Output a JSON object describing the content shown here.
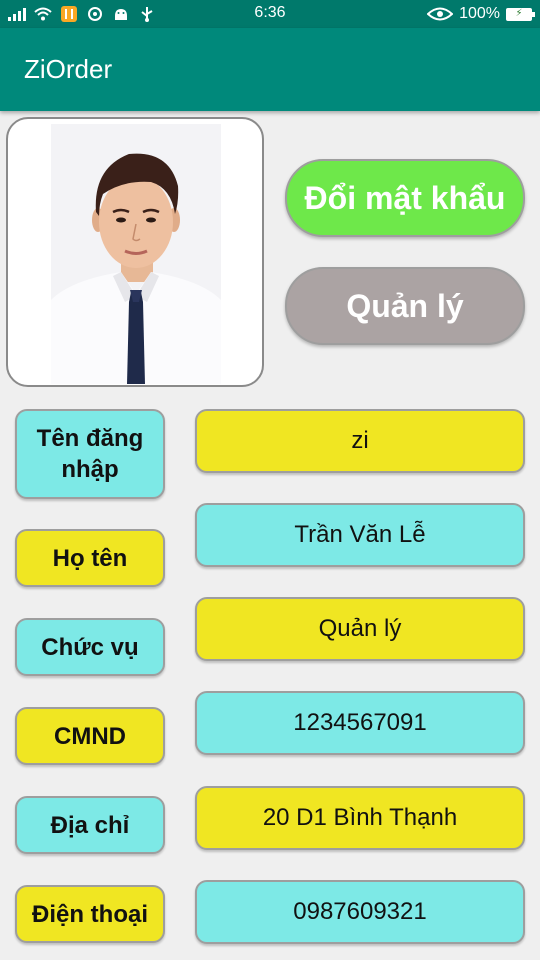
{
  "status_bar": {
    "time": "6:36",
    "battery": "100%",
    "left_icons": [
      "signal-icon",
      "wifi-icon",
      "app-notification-icon",
      "sync-icon",
      "android-icon",
      "usb-icon"
    ],
    "right_icons": [
      "eye-icon",
      "battery-icon"
    ]
  },
  "app_bar": {
    "title": "ZiOrder"
  },
  "actions": {
    "change_password": "Đổi mật khẩu",
    "manage": "Quản lý"
  },
  "profile": {
    "fields": [
      {
        "label": "Tên đăng nhập",
        "value": "zi"
      },
      {
        "label": "Họ tên",
        "value": "Trần Văn Lễ"
      },
      {
        "label": "Chức vụ",
        "value": "Quản lý"
      },
      {
        "label": "CMND",
        "value": "1234567091"
      },
      {
        "label": "Địa chỉ",
        "value": "20 D1 Bình Thạnh"
      },
      {
        "label": "Điện thoại",
        "value": "0987609321"
      }
    ]
  },
  "colors": {
    "app_bar": "#00897b",
    "status_bar": "#00796b",
    "cyan_box": "#7de9e6",
    "yellow_box": "#f0e622",
    "change_password_button": "#6ee84a",
    "manage_button": "#aba3a3"
  }
}
